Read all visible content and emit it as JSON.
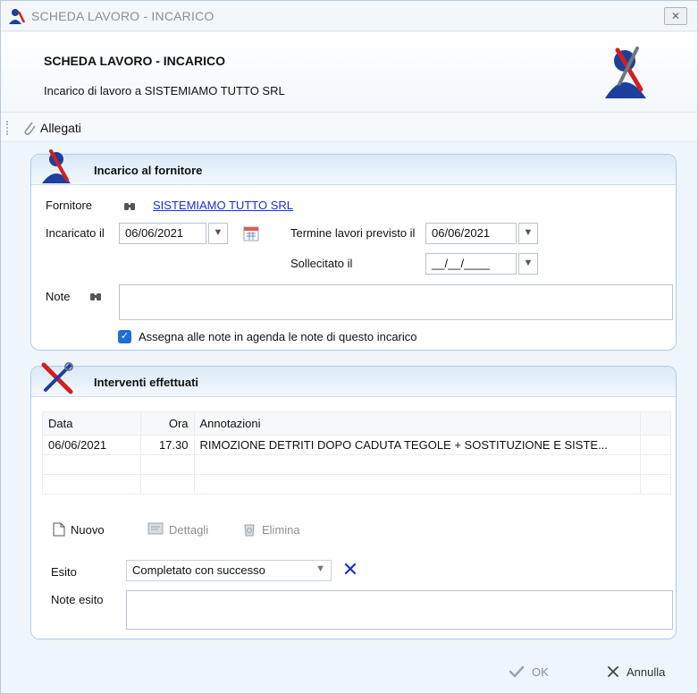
{
  "window": {
    "title": "SCHEDA LAVORO - INCARICO",
    "close_glyph": "✕"
  },
  "header": {
    "title": "SCHEDA LAVORO - INCARICO",
    "subtitle": "Incarico di lavoro a SISTEMIAMO TUTTO SRL"
  },
  "toolbar": {
    "attachments_label": "Allegati"
  },
  "assignment": {
    "title": "Incarico al fornitore",
    "supplier_label": "Fornitore",
    "supplier_value": "SISTEMIAMO TUTTO SRL",
    "assigned_label": "Incaricato il",
    "assigned_value": "06/06/2021",
    "deadline_label": "Termine lavori previsto il",
    "deadline_value": "06/06/2021",
    "reminder_label": "Sollecitato il",
    "reminder_value": "__/__/____",
    "notes_label": "Note",
    "notes_value": "",
    "agenda_checkbox_label": "Assegna alle note in agenda le note di questo incarico",
    "agenda_checked": true
  },
  "interventions": {
    "title": "Interventi effettuati",
    "columns": {
      "date": "Data",
      "time": "Ora",
      "notes": "Annotazioni"
    },
    "rows": [
      {
        "date": "06/06/2021",
        "time": "17.30",
        "notes": "RIMOZIONE DETRITI DOPO CADUTA TEGOLE + SOSTITUZIONE E SISTE..."
      }
    ],
    "new_label": "Nuovo",
    "details_label": "Dettagli",
    "delete_label": "Elimina",
    "outcome_label": "Esito",
    "outcome_value": "Completato con successo",
    "outcome_notes_label": "Note esito",
    "outcome_notes_value": ""
  },
  "footer": {
    "ok_label": "OK",
    "cancel_label": "Annulla"
  },
  "colors": {
    "link": "#1b2fd9",
    "accent": "#1f6fd0",
    "clear_x": "#1b2fd9",
    "panel_border": "#aecbe6"
  }
}
